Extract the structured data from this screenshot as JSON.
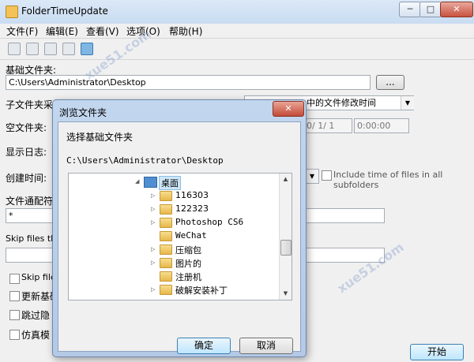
{
  "window": {
    "title": "FolderTimeUpdate",
    "min_glyph": "─",
    "max_glyph": "□",
    "close_glyph": "✕"
  },
  "menu": [
    "文件(F)",
    "编辑(E)",
    "查看(V)",
    "选项(O)",
    "帮助(H)"
  ],
  "toolbar_icons": [
    "save-icon",
    "copy-icon",
    "properties-icon",
    "find-icon",
    "exit-icon"
  ],
  "form": {
    "base_folder_label": "基础文件夹:",
    "base_folder_value": "C:\\Users\\Administrator\\Desktop",
    "browse_label": "...",
    "subfolder_label": "子文件夹采",
    "subfolder_combo_partial": "中的文件修改时间",
    "empty_folder_label": "空文件夹:",
    "date_partial": "0/ 1/ 1",
    "time_value": "0:00:00",
    "show_log_label": "显示日志:",
    "create_time_label": "创建时间:",
    "include_time_label": "Include time of files in all subfolders",
    "wildcard_label": "文件通配符",
    "wildcard_value": "*",
    "skip_files_label": "Skip files tha",
    "checkbox1_label": "Skip files",
    "checkbox2_label": "更新基础",
    "checkbox3_label": "跳过隐",
    "checkbox4_label": "仿真模",
    "start_label": "开始"
  },
  "dialog": {
    "title": "浏览文件夹",
    "close_glyph": "✕",
    "prompt": "选择基础文件夹",
    "path": "C:\\Users\\Administrator\\Desktop",
    "root_node": "桌面",
    "items": [
      "116303",
      "122323",
      "Photoshop CS6",
      "WeChat",
      "压缩包",
      "图片的",
      "注册机",
      "破解安装补丁"
    ],
    "ok_label": "确定",
    "cancel_label": "取消"
  },
  "watermark": "xue51.com"
}
